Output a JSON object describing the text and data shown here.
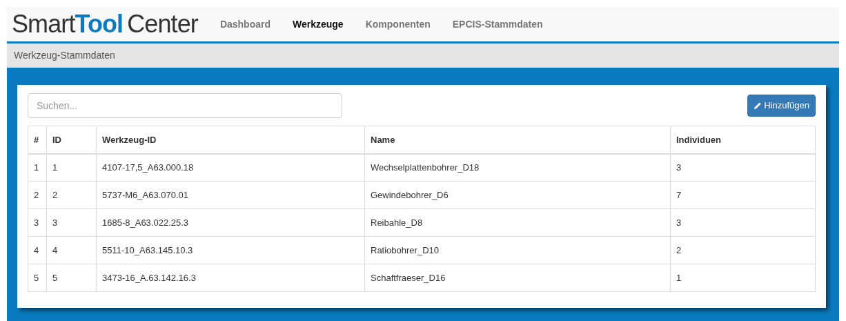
{
  "logo": "Smart**Tool**Center",
  "nav": [
    {
      "label": "Dashboard",
      "selected": false
    },
    {
      "label": "Werkzeuge",
      "selected": true
    },
    {
      "label": "Komponenten",
      "selected": false
    },
    {
      "label": "EPCIS-Stammdaten",
      "selected": false
    }
  ],
  "breadcrumb": "Werkzeug-Stammdaten",
  "search": {
    "placeholder": "Suchen..."
  },
  "add_button": "Hinzufügen",
  "table": {
    "columns": [
      "#",
      "ID",
      "Werkzeug-ID",
      "Name",
      "Individuen"
    ],
    "rows": [
      [
        "1",
        "1",
        "4107-17,5_A63.000.18",
        "Wechselplattenbohrer_D18",
        "3"
      ],
      [
        "2",
        "2",
        "5737-M6_A63.070.01",
        "Gewindebohrer_D6",
        "7"
      ],
      [
        "3",
        "3",
        "1685-8_A63.022.25.3",
        "Reibahle_D8",
        "3"
      ],
      [
        "4",
        "4",
        "5511-10_A63.145.10.3",
        "Ratiobohrer_D10",
        "2"
      ],
      [
        "5",
        "5",
        "3473-16_A.63.142.16.3",
        "Schaftfraeser_D16",
        "1"
      ]
    ]
  }
}
